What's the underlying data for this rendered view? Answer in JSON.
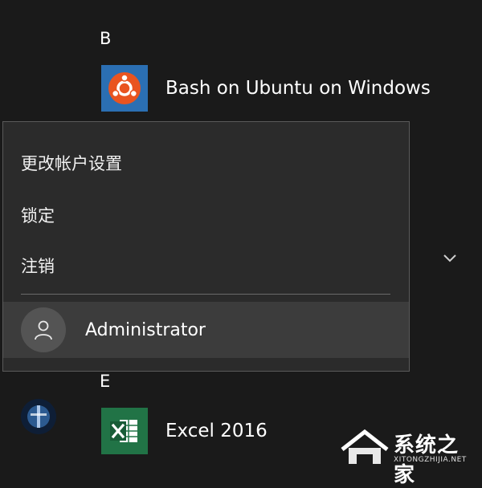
{
  "start_menu": {
    "section_b": "B",
    "section_e": "E",
    "apps": {
      "bash": {
        "label": "Bash on Ubuntu on Windows",
        "icon": "ubuntu-icon",
        "tile_color": "#2b6fb3"
      },
      "excel": {
        "label": "Excel 2016",
        "icon": "excel-icon",
        "tile_color": "#217346"
      }
    },
    "expand_icon": "chevron-down-icon"
  },
  "account_menu": {
    "items": [
      {
        "label": "更改帐户设置"
      },
      {
        "label": "锁定"
      },
      {
        "label": "注销"
      }
    ],
    "user": {
      "name": "Administrator",
      "icon": "person-icon"
    }
  },
  "watermark": {
    "text": "系统之家",
    "subtext": "XITONGZHIJIA.NET"
  }
}
